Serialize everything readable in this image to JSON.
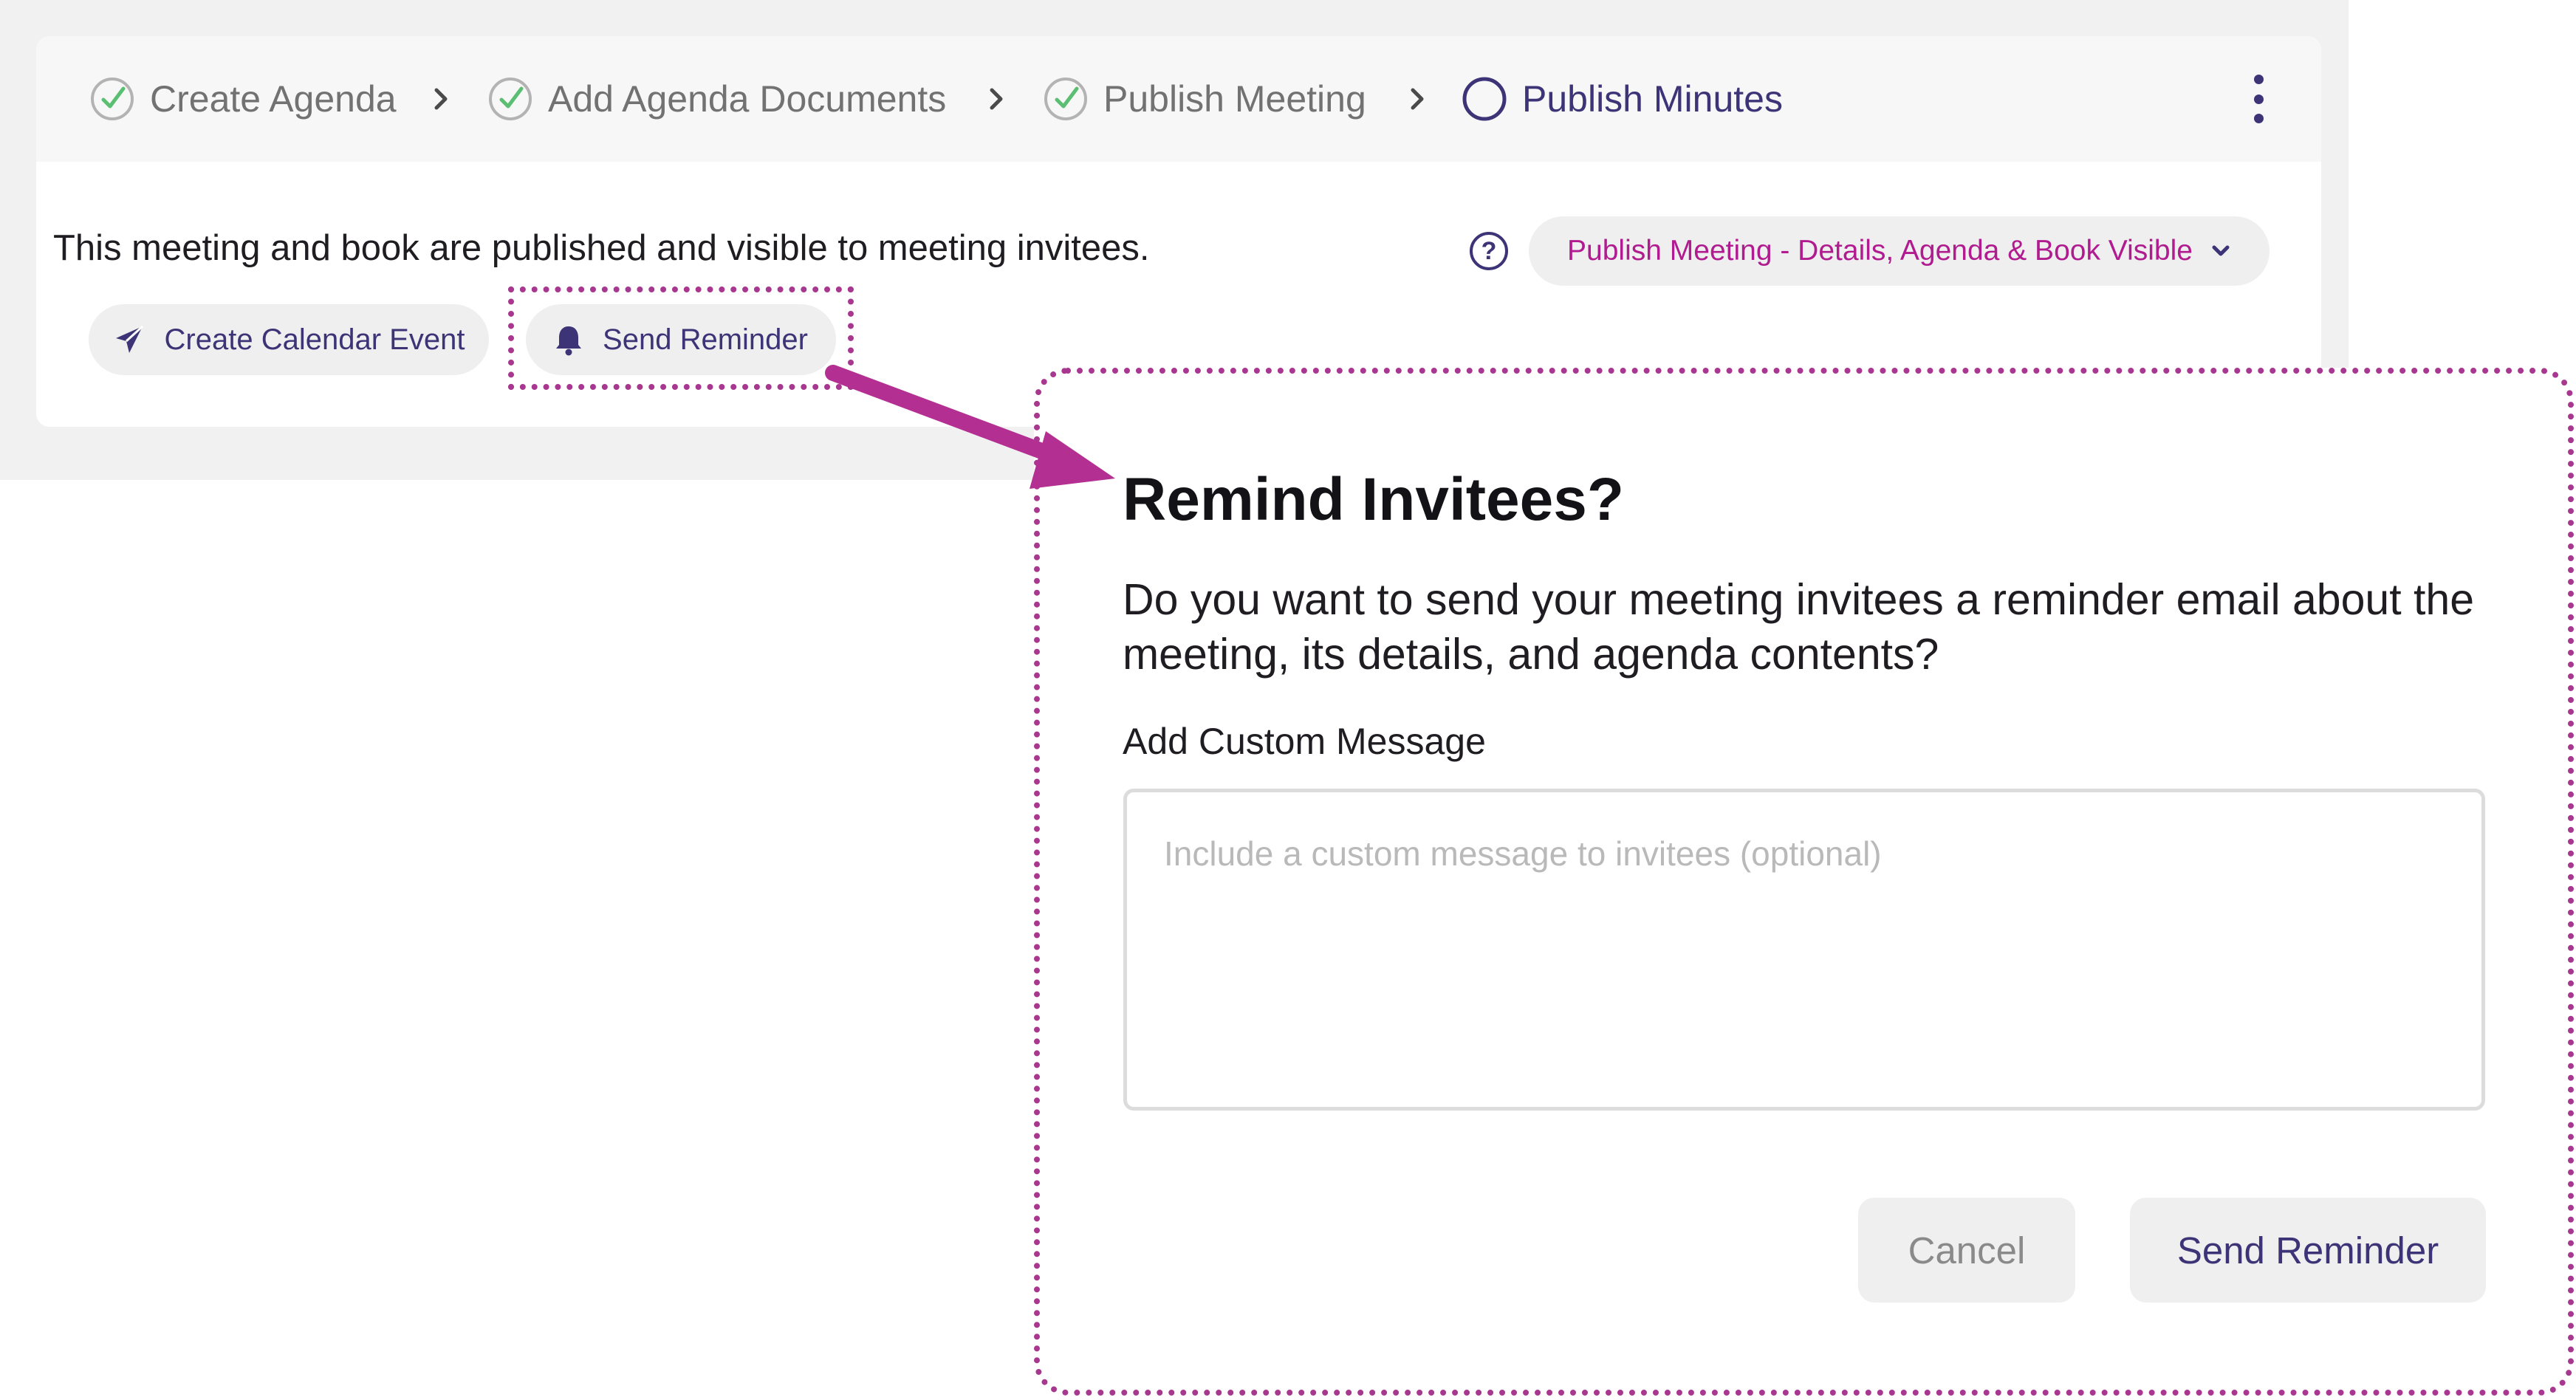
{
  "stepper": {
    "steps": [
      {
        "label": "Create Agenda",
        "status": "done"
      },
      {
        "label": "Add Agenda Documents",
        "status": "done"
      },
      {
        "label": "Publish Meeting",
        "status": "done"
      },
      {
        "label": "Publish Minutes",
        "status": "current"
      }
    ]
  },
  "publish": {
    "message": "This meeting and book are published and visible to meeting invitees.",
    "status_selected": "Publish Meeting - Details, Agenda & Book Visible",
    "help_glyph": "?"
  },
  "actions": {
    "create_calendar_event": "Create Calendar Event",
    "send_reminder": "Send Reminder"
  },
  "modal": {
    "title": "Remind Invitees?",
    "question": "Do you want to send your meeting invitees a reminder email about the meeting, its details, and agenda contents?",
    "field_label": "Add Custom Message",
    "field_value": "",
    "field_placeholder": "Include a custom message to invitees (optional)",
    "cancel_label": "Cancel",
    "confirm_label": "Send Reminder"
  },
  "colors": {
    "brand_purple": "#3d3477",
    "accent_magenta": "#b01c8f",
    "annotation": "#a8378f",
    "check_green": "#5bbf73"
  },
  "icons": [
    "check-circle-icon",
    "circle-outline-icon",
    "chevron-right-icon",
    "kebab-menu-icon",
    "help-icon",
    "chevron-down-icon",
    "paper-plane-icon",
    "bell-icon",
    "callout-arrow"
  ]
}
